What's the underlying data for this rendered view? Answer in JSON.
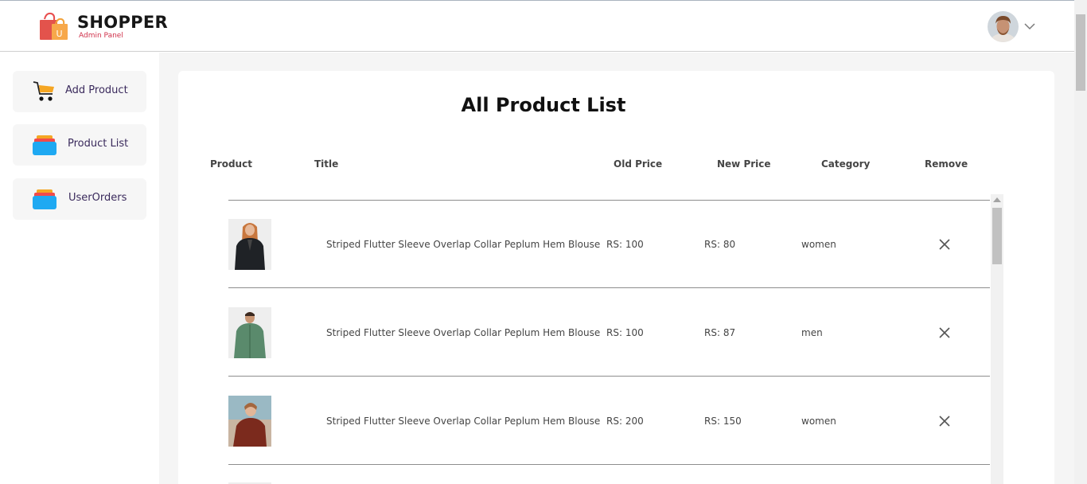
{
  "header": {
    "brand": "SHOPPER",
    "subtitle": "Admin Panel",
    "logo_icon": "shopping-bag-icon",
    "avatar": "user-avatar",
    "menu_icon": "chevron-down-icon"
  },
  "sidebar": {
    "items": [
      {
        "label": "Add Product",
        "icon": "cart-icon"
      },
      {
        "label": "Product List",
        "icon": "list-stack-icon"
      },
      {
        "label": "UserOrders",
        "icon": "orders-stack-icon"
      }
    ]
  },
  "main": {
    "title": "All Product List",
    "columns": [
      "Product",
      "Title",
      "Old Price",
      "New Price",
      "Category",
      "Remove"
    ],
    "rows": [
      {
        "image": "woman-black-jacket",
        "title": "Striped Flutter Sleeve Overlap Collar Peplum Hem Blouse",
        "old_price": "RS: 100",
        "new_price": "RS: 80",
        "category": "women"
      },
      {
        "image": "man-green-jacket",
        "title": "Striped Flutter Sleeve Overlap Collar Peplum Hem Blouse",
        "old_price": "RS: 100",
        "new_price": "RS: 87",
        "category": "men"
      },
      {
        "image": "woman-red-top",
        "title": "Striped Flutter Sleeve Overlap Collar Peplum Hem Blouse",
        "old_price": "RS: 200",
        "new_price": "RS: 150",
        "category": "women"
      }
    ],
    "remove_icon": "close-icon"
  },
  "colors": {
    "brand_accent": "#d0314b",
    "sidebar_text": "#3a2a5c",
    "page_bg": "#f5f5f5"
  }
}
